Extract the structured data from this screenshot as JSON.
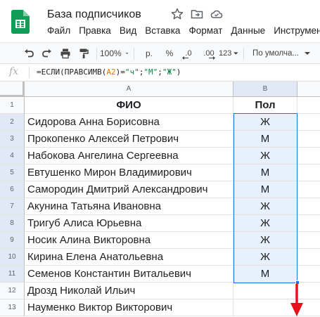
{
  "app": {
    "title": "База подписчиков",
    "icons": [
      "star-icon",
      "move-to-folder-icon",
      "cloud-status-icon"
    ],
    "menu": [
      "Файл",
      "Правка",
      "Вид",
      "Вставка",
      "Формат",
      "Данные",
      "Инструмен"
    ]
  },
  "toolbar": {
    "zoom": "100%",
    "currency": "р.",
    "percent": "%",
    "decrease_decimals": ".0",
    "increase_decimals": ".00",
    "number_format": "123",
    "font": "По умолча..."
  },
  "formula_bar": {
    "fx": "fx",
    "formula": {
      "part1": "=ЕСЛИ(ПРАВСИМВ(",
      "ref": "A2",
      "part2": ")=",
      "str1": "\"ч\"",
      "sep1": ";",
      "str2": "\"М\"",
      "sep2": ";",
      "str3": "\"Ж\"",
      "part3": ")"
    }
  },
  "grid": {
    "columns": [
      "A",
      "B"
    ],
    "rows": [
      {
        "num": "1",
        "fio": "ФИО",
        "pol": "Пол"
      },
      {
        "num": "2",
        "fio": "Сидорова Анна Борисовна",
        "pol": "Ж"
      },
      {
        "num": "3",
        "fio": "Прокопенко Алексей Петрович",
        "pol": "М"
      },
      {
        "num": "4",
        "fio": "Набокова Ангелина Сергеевна",
        "pol": "Ж"
      },
      {
        "num": "5",
        "fio": "Евтушенко Мирон Владимирович",
        "pol": "М"
      },
      {
        "num": "6",
        "fio": "Самородин Дмитрий Александрович",
        "pol": "М"
      },
      {
        "num": "7",
        "fio": "Акунина Татьяна Ивановна",
        "pol": "Ж"
      },
      {
        "num": "8",
        "fio": "Тригуб Алиса Юрьевна",
        "pol": "Ж"
      },
      {
        "num": "9",
        "fio": "Носик Алина Викторовна",
        "pol": "Ж"
      },
      {
        "num": "10",
        "fio": "Кирина Елена Анатольевна",
        "pol": "Ж"
      },
      {
        "num": "11",
        "fio": "Семенов Константин Витальевич",
        "pol": "М"
      },
      {
        "num": "12",
        "fio": "Дрозд Николай Ильич",
        "pol": ""
      },
      {
        "num": "13",
        "fio": "Науменко Виктор Викторович",
        "pol": ""
      }
    ]
  },
  "colors": {
    "selection": "#1a73e8",
    "selection_fill": "#e7f0fd",
    "arrow": "#e8121f",
    "sheets_green": "#0f9d58"
  }
}
